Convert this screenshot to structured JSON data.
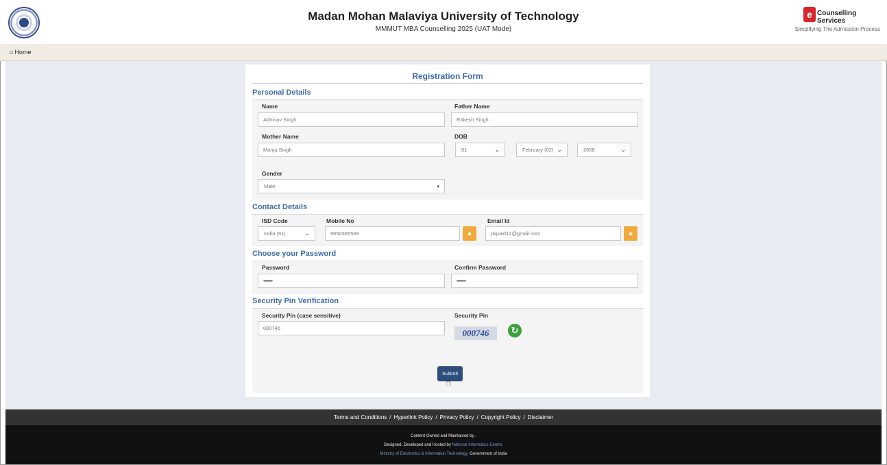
{
  "header": {
    "title": "Madan Mohan Malaviya University of Technology",
    "subtitle": "MMMUT MBA Counselling 2025 (UAT Mode)",
    "brand_icon_letter": "e",
    "brand_name": "Counselling Services",
    "brand_tagline": "Simplifying The Admission Process"
  },
  "nav": {
    "home_label": "Home"
  },
  "form": {
    "title": "Registration Form",
    "personal": {
      "section_title": "Personal Details",
      "name_label": "Name",
      "name_value": "Abhinav Singh",
      "father_label": "Father Name",
      "father_value": "Rakesh Singh",
      "mother_label": "Mother Name",
      "mother_value": "Manju Singh",
      "dob_label": "DOB",
      "dob_day": "01",
      "dob_month": "February (02)",
      "dob_year": "2008",
      "gender_label": "Gender",
      "gender_value": "Male"
    },
    "contact": {
      "section_title": "Contact Details",
      "isd_label": "ISD Code",
      "isd_value": "India (91)",
      "mobile_label": "Mobile No",
      "mobile_value": "9650385569",
      "email_label": "Email Id",
      "email_value": "pkpald12@gmail.com"
    },
    "password": {
      "section_title": "Choose your Password",
      "password_label": "Password",
      "password_value": "••••••••",
      "confirm_label": "Confirm Password",
      "confirm_value": "••••••••"
    },
    "security": {
      "section_title": "Security Pin Verification",
      "pin_label": "Security Pin (case sensitive)",
      "pin_value": "000746",
      "captcha_label": "Security Pin",
      "captcha_value": "000746"
    },
    "submit_label": "Submit"
  },
  "footer": {
    "links": [
      "Terms and Conditions",
      "Hyperlink Policy",
      "Privacy Policy",
      "Copyright Policy",
      "Disclaimer"
    ],
    "owned": "Content Owned and Maintained by .",
    "designed_prefix": "Designed, Developed and Hosted by",
    "nic": "National Informatics Centre,",
    "ministry": "Ministry of Electronics & Information Technology,",
    "government": "Government of India"
  },
  "colors": {
    "accent": "#3e6ba8",
    "warning": "#f0a93b",
    "submit": "#2d4d7a",
    "brand_red": "#d8262c"
  }
}
